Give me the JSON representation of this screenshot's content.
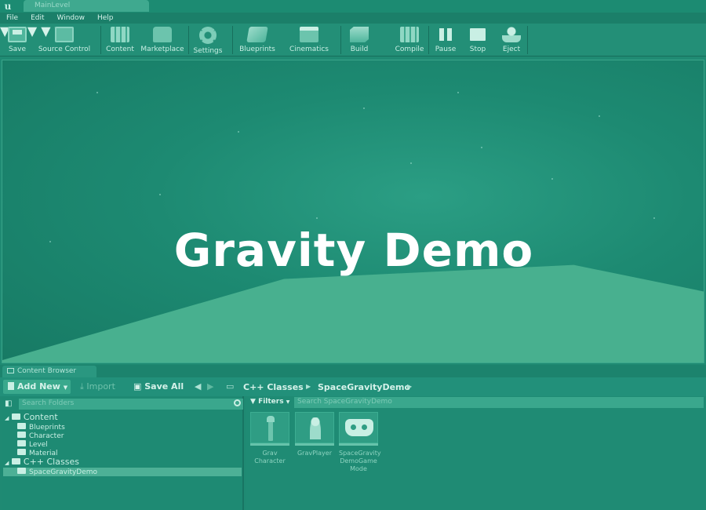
{
  "window": {
    "level_tab": "MainLevel"
  },
  "menu": [
    "File",
    "Edit",
    "Window",
    "Help"
  ],
  "toolbar": [
    {
      "label": "Save",
      "icon": "save-icon"
    },
    {
      "label": "Source Control",
      "icon": "source-control-icon"
    },
    {
      "label": "Content",
      "icon": "content-icon"
    },
    {
      "label": "Marketplace",
      "icon": "marketplace-icon"
    },
    {
      "label": "Settings",
      "icon": "settings-icon"
    },
    {
      "label": "Blueprints",
      "icon": "blueprints-icon"
    },
    {
      "label": "Cinematics",
      "icon": "cinematics-icon"
    },
    {
      "label": "Build",
      "icon": "build-icon"
    },
    {
      "label": "Compile",
      "icon": "compile-icon"
    },
    {
      "label": "Pause",
      "icon": "pause-icon"
    },
    {
      "label": "Stop",
      "icon": "stop-icon"
    },
    {
      "label": "Eject",
      "icon": "eject-icon"
    }
  ],
  "viewport": {
    "title": "Gravity Demo"
  },
  "content_browser": {
    "tab": "Content Browser",
    "add_new": "Add New",
    "import": "Import",
    "save_all": "Save All",
    "breadcrumb": [
      "C++ Classes",
      "SpaceGravityDemo"
    ],
    "search_folders_placeholder": "Search Folders",
    "filters": "Filters",
    "search_assets_placeholder": "Search SpaceGravityDemo",
    "tree": {
      "content": "Content",
      "children": [
        "Blueprints",
        "Character",
        "Level",
        "Material"
      ],
      "cpp_classes": "C++ Classes",
      "selected": "SpaceGravityDemo"
    },
    "assets": [
      {
        "name": "Grav Character",
        "icon": "character-icon"
      },
      {
        "name": "GravPlayer",
        "icon": "pawn-icon"
      },
      {
        "name": "SpaceGravity DemoGame Mode",
        "icon": "gamepad-icon"
      }
    ]
  },
  "colors": {
    "tint": "#1f8a73",
    "accent": "#3aa98d",
    "text": "#d6f2ea"
  }
}
